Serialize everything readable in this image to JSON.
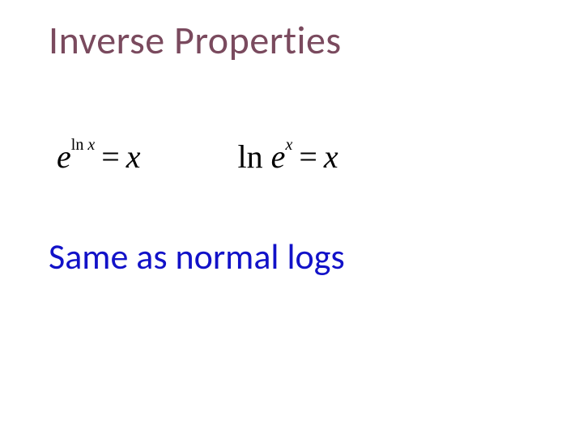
{
  "title": "Inverse Properties",
  "equations": {
    "eq1": {
      "base": "e",
      "exp_fn": "ln",
      "exp_var": "x",
      "rhs": "x"
    },
    "eq2": {
      "lhs_fn": "ln",
      "lhs_base": "e",
      "lhs_exp": "x",
      "rhs": "x"
    }
  },
  "subtitle": "Same as normal logs"
}
